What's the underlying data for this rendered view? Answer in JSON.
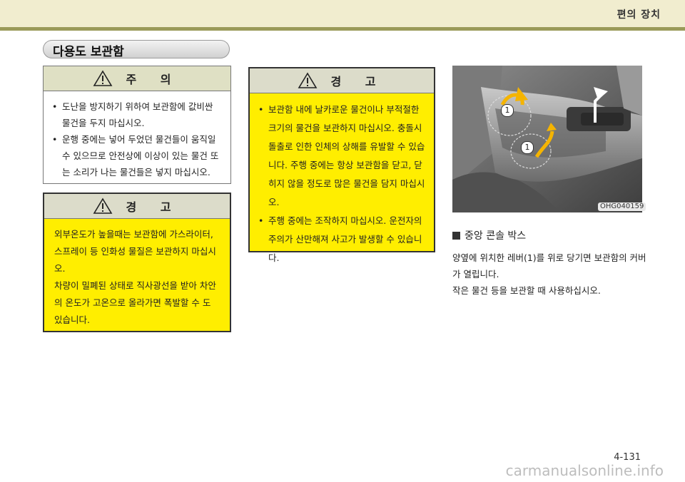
{
  "header": {
    "title": "편의 장치"
  },
  "section_title": "다용도 보관함",
  "caution": {
    "title": "주   의",
    "items": [
      "도난을 방지하기 위하여 보관함에 값비싼 물건을 두지 마십시오.",
      "운행 중에는 넣어 두었던 물건들이 움직일 수 있으므로 안전상에 이상이 있는 물건 또는 소리가 나는 물건들은 넣지 마십시오."
    ]
  },
  "warning_left": {
    "title": "경   고",
    "paragraphs": [
      "외부온도가 높을때는 보관함에 가스라이터, 스프레이 등 인화성 물질은 보관하지 마십시오.",
      "차량이 밀폐된 상태로 직사광선을 받아 차안의 온도가 고온으로 올라가면 폭발할 수 도 있습니다."
    ]
  },
  "warning_center": {
    "title": "경   고",
    "items": [
      "보관함 내에 날카로운 물건이나 부적절한 크기의 물건을 보관하지 마십시오. 충돌시 돌출로 인한 인체의 상해를 유발할 수 있습니다. 주행 중에는 항상 보관함을 닫고, 닫히지 않을 정도로 많은 물건을 담지 마십시오.",
      "주행 중에는 조작하지 마십시오. 운전자의 주의가 산만해져 사고가 발생할 수 있습니다."
    ]
  },
  "photo": {
    "code": "OHG040159",
    "marker_1": "1",
    "marker_2": "1"
  },
  "right": {
    "title": "중앙 콘솔 박스",
    "body": [
      "양옆에 위치한 레버(1)를 위로 당기면 보관함의 커버가 열립니다.",
      "작은 물건 등을 보관할 때 사용하십시오."
    ]
  },
  "page_number": "4-131",
  "watermark": "carmanualsonline.info"
}
